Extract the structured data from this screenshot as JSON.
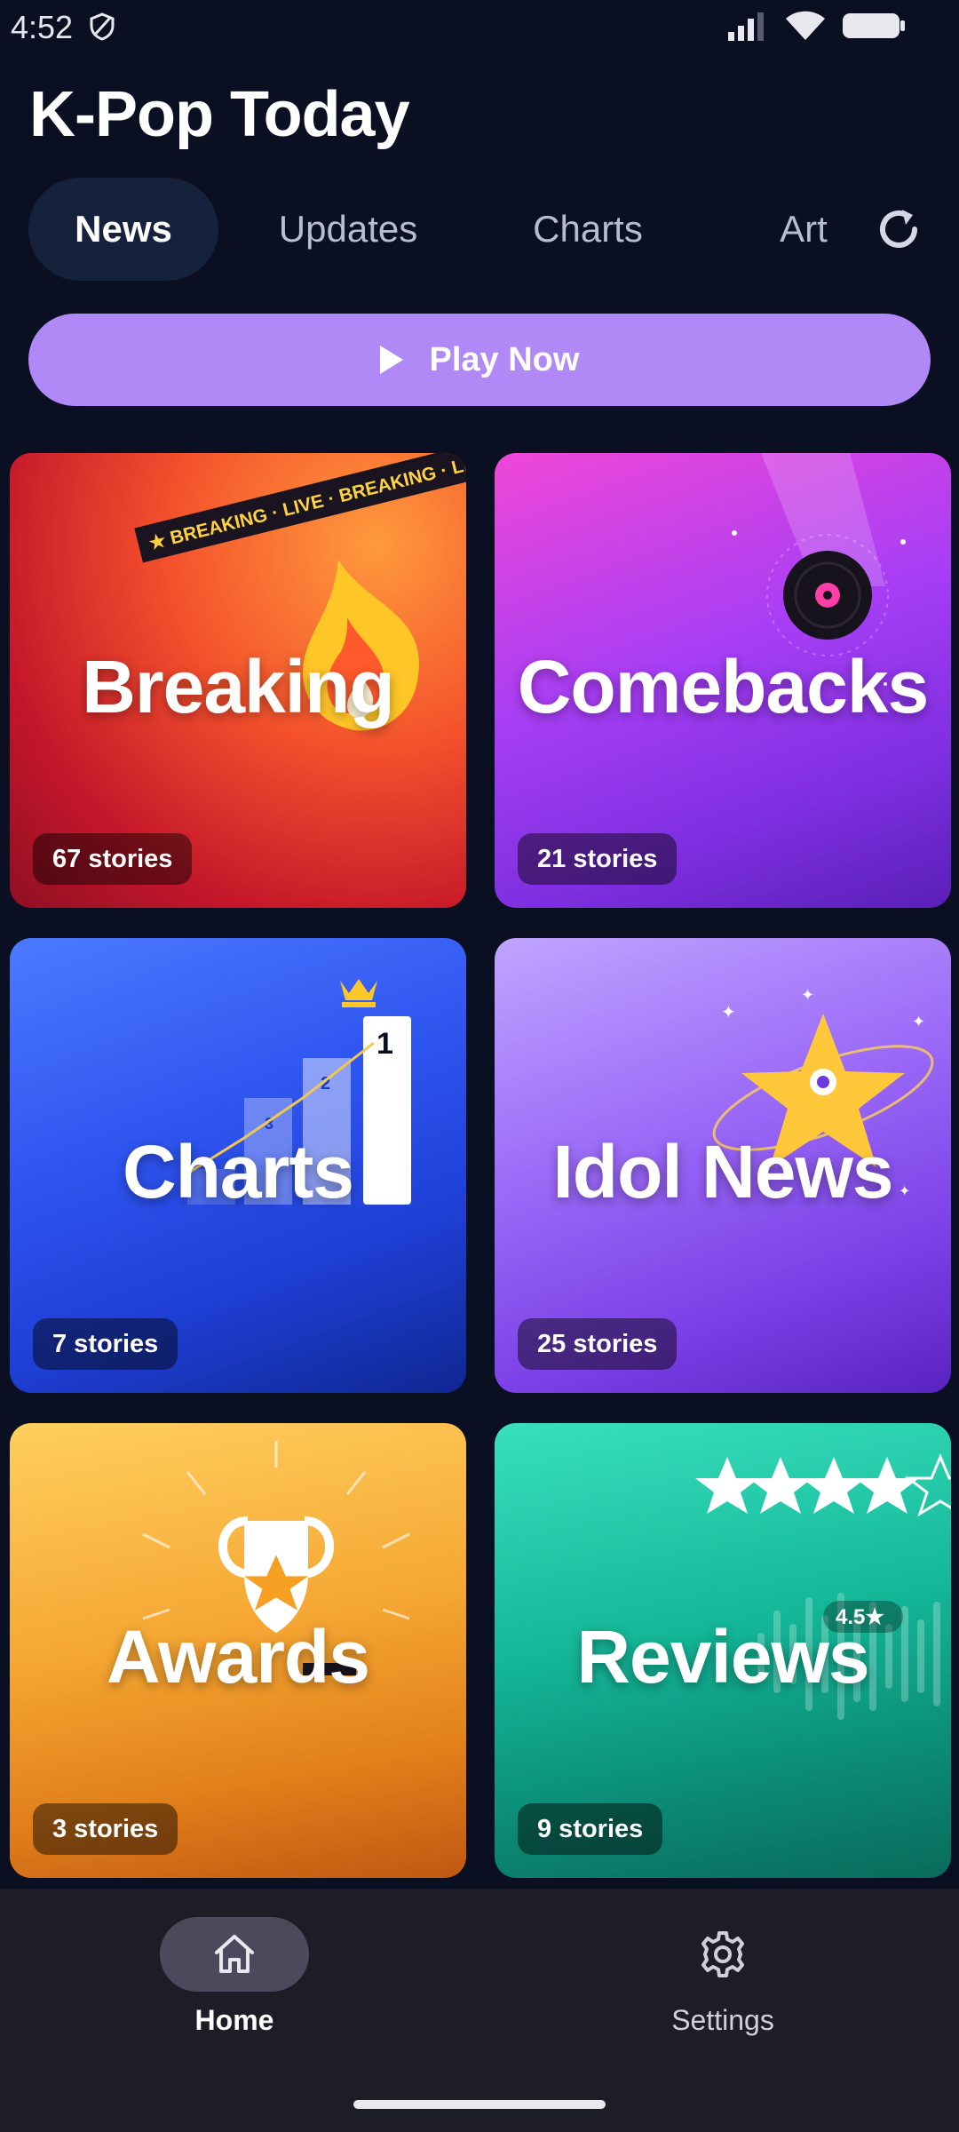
{
  "status_bar": {
    "time": "4:52"
  },
  "app": {
    "title": "K-Pop Today"
  },
  "tabs": [
    {
      "label": "News",
      "active": true
    },
    {
      "label": "Updates",
      "active": false
    },
    {
      "label": "Charts",
      "active": false
    },
    {
      "label": "Art",
      "active": false
    }
  ],
  "actions": {
    "play_label": "Play Now",
    "refresh_icon": "refresh-icon",
    "play_icon": "play-icon"
  },
  "cards": [
    {
      "title": "Breaking",
      "count": "67 stories",
      "banner": "★ BREAKING · LIVE · BREAKING · LIVE",
      "icon": "flame-icon"
    },
    {
      "title": "Comebacks",
      "count": "21 stories",
      "icon": "vinyl-record-icon"
    },
    {
      "title": "Charts",
      "count": "7 stories",
      "icon": "bar-chart-icon",
      "ranks": [
        "1",
        "2",
        "3"
      ]
    },
    {
      "title": "Idol News",
      "count": "25 stories",
      "icon": "star-icon"
    },
    {
      "title": "Awards",
      "count": "3 stories",
      "icon": "trophy-icon"
    },
    {
      "title": "Reviews",
      "count": "9 stories",
      "icon": "rating-stars-icon",
      "rating_badge": "4.5★"
    }
  ],
  "bottom_nav": [
    {
      "label": "Home",
      "icon": "home-icon",
      "active": true
    },
    {
      "label": "Settings",
      "icon": "gear-icon",
      "active": false
    }
  ],
  "colors": {
    "background": "#0b0f22",
    "accent": "#b189f6",
    "nav_background": "#1d1d28"
  }
}
